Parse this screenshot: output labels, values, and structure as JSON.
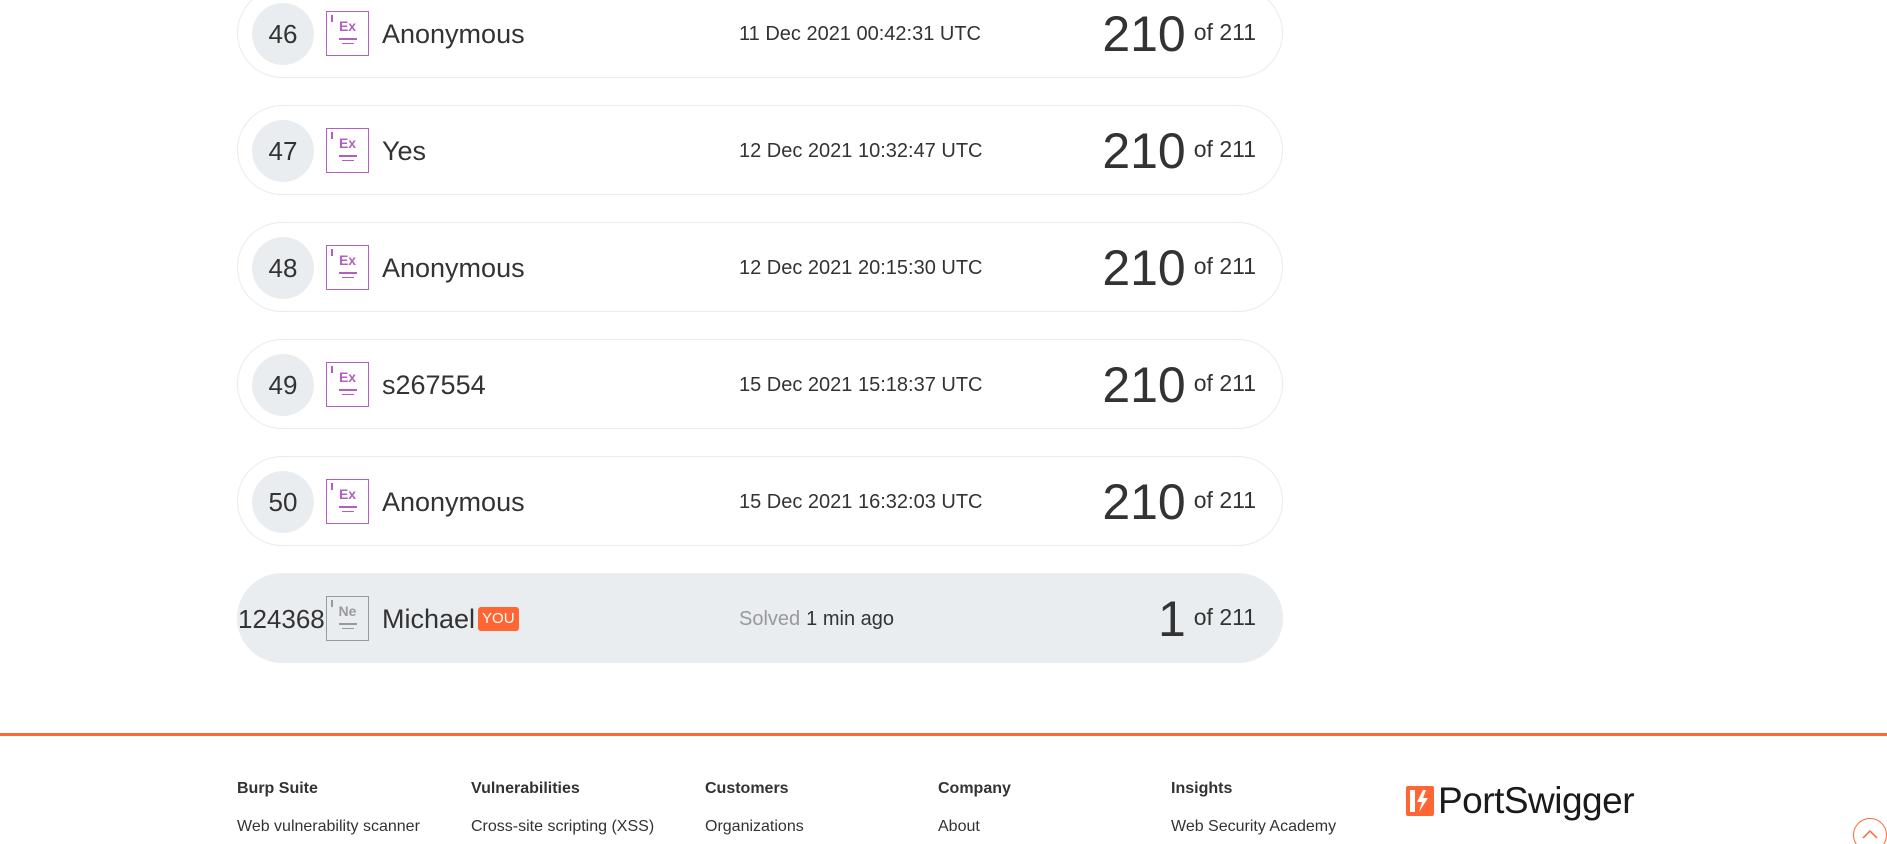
{
  "leaderboard": {
    "rows": [
      {
        "rank": "46",
        "badge": "Ex",
        "name": "Anonymous",
        "date": "11 Dec 2021 00:42:31 UTC",
        "score": "210",
        "total": "of 211"
      },
      {
        "rank": "47",
        "badge": "Ex",
        "name": "Yes",
        "date": "12 Dec 2021 10:32:47 UTC",
        "score": "210",
        "total": "of 211"
      },
      {
        "rank": "48",
        "badge": "Ex",
        "name": "Anonymous",
        "date": "12 Dec 2021 20:15:30 UTC",
        "score": "210",
        "total": "of 211"
      },
      {
        "rank": "49",
        "badge": "Ex",
        "name": "s267554",
        "date": "15 Dec 2021 15:18:37 UTC",
        "score": "210",
        "total": "of 211"
      },
      {
        "rank": "50",
        "badge": "Ex",
        "name": "Anonymous",
        "date": "15 Dec 2021 16:32:03 UTC",
        "score": "210",
        "total": "of 211"
      }
    ],
    "current_user": {
      "rank": "124368",
      "badge": "Ne",
      "name": "Michael",
      "you_label": "YOU",
      "solved_label": "Solved",
      "time": "1 min ago",
      "score": "1",
      "total": "of 211"
    }
  },
  "footer": {
    "columns": [
      {
        "heading": "Burp Suite",
        "link": "Web vulnerability scanner"
      },
      {
        "heading": "Vulnerabilities",
        "link": "Cross-site scripting (XSS)"
      },
      {
        "heading": "Customers",
        "link": "Organizations"
      },
      {
        "heading": "Company",
        "link": "About"
      },
      {
        "heading": "Insights",
        "link": "Web Security Academy"
      }
    ],
    "logo_text": "PortSwigger"
  },
  "colors": {
    "accent": "#ff6633",
    "badge_expert": "#b25fc1",
    "badge_newcomer": "#9a9a9a",
    "row_highlight": "#e9edf0"
  },
  "icons": {
    "logo": "portswigger-bolt-icon",
    "scroll_top": "chevron-up-icon"
  }
}
